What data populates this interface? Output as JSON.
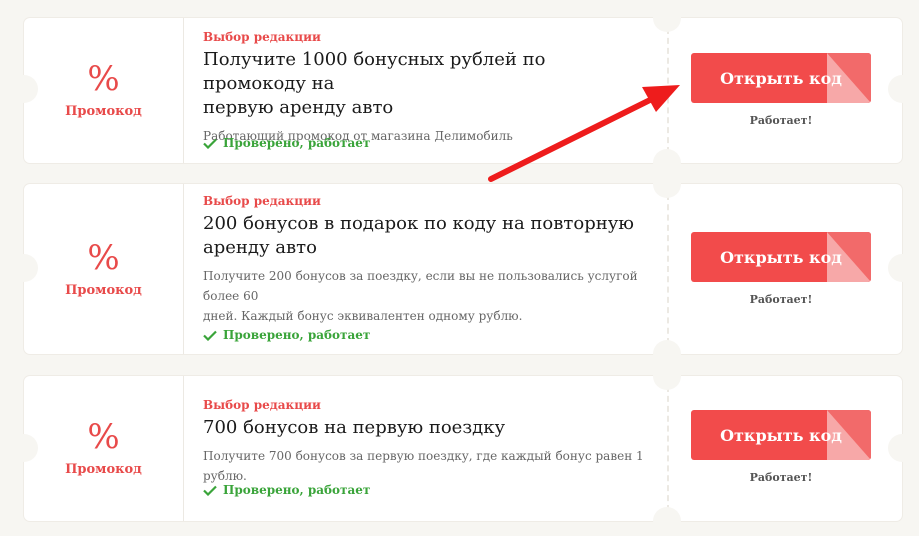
{
  "offers": [
    {
      "percent": "%",
      "type_label": "Промокод",
      "badge": "Выбор редакции",
      "title_lines": [
        "Получите 1000 бонусных рублей по промокоду на",
        "первую аренду авто"
      ],
      "description_lines": [
        "Работающий промокод от магазина Делимобиль"
      ],
      "verified": "Проверено, работает",
      "button_label": "Открыть код",
      "status": "Работает!"
    },
    {
      "percent": "%",
      "type_label": "Промокод",
      "badge": "Выбор редакции",
      "title_lines": [
        "200 бонусов в подарок по коду на повторную",
        "аренду авто"
      ],
      "description_lines": [
        "Получите 200 бонусов за поездку, если вы не пользовались услугой более 60",
        "дней. Каждый бонус эквивалентен одному рублю."
      ],
      "verified": "Проверено, работает",
      "button_label": "Открыть код",
      "status": "Работает!"
    },
    {
      "percent": "%",
      "type_label": "Промокод",
      "badge": "Выбор редакции",
      "title_lines": [
        "700 бонусов на первую поездку"
      ],
      "description_lines": [
        "Получите 700 бонусов за первую поездку, где каждый бонус равен 1 рублю."
      ],
      "verified": "Проверено, работает",
      "button_label": "Открыть код",
      "status": "Работает!"
    }
  ],
  "colors": {
    "accent": "#e84a4a",
    "button": "#f24b4b",
    "verified": "#3aa43a",
    "arrow": "#ee1c1c"
  }
}
